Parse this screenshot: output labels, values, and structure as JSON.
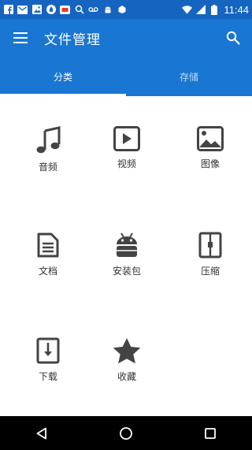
{
  "status_bar": {
    "time": "11:44",
    "icons": [
      "facebook-icon",
      "gmail-icon",
      "photos-icon",
      "drop-icon",
      "badge-icon",
      "search-icon",
      "voicemail-icon",
      "android-icon",
      "notification-icon",
      "wifi-icon",
      "signal-icon",
      "battery-icon"
    ]
  },
  "app_bar": {
    "title": "文件管理",
    "menu_icon": "menu-icon",
    "search_icon": "search-icon"
  },
  "tabs": [
    {
      "label": "分类",
      "active": true
    },
    {
      "label": "存储",
      "active": false
    }
  ],
  "categories": [
    {
      "label": "音频",
      "icon": "music-note-icon"
    },
    {
      "label": "视频",
      "icon": "video-play-icon"
    },
    {
      "label": "图像",
      "icon": "image-icon"
    },
    {
      "label": "文档",
      "icon": "document-icon"
    },
    {
      "label": "安装包",
      "icon": "android-robot-icon"
    },
    {
      "label": "压缩",
      "icon": "zip-archive-icon"
    },
    {
      "label": "下载",
      "icon": "download-icon"
    },
    {
      "label": "收藏",
      "icon": "star-icon"
    }
  ],
  "colors": {
    "status_bar": "#1565c0",
    "app_bar": "#1976d2",
    "icon_gray": "#444444",
    "nav_bar": "#000000"
  },
  "nav_bar": {
    "buttons": [
      "back-triangle-icon",
      "home-circle-icon",
      "recents-square-icon"
    ]
  }
}
